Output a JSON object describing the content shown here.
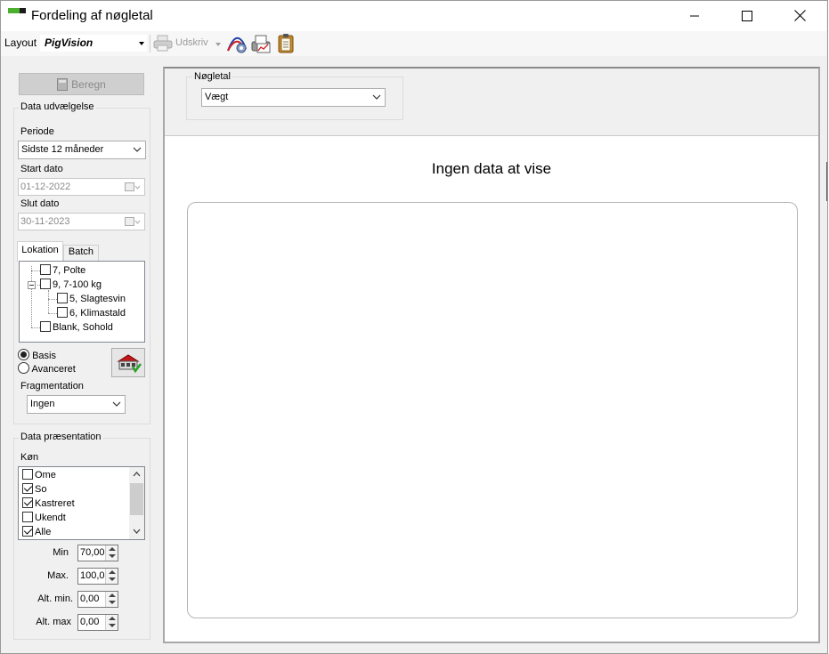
{
  "window": {
    "title": "Fordeling af nøgletal",
    "controls": [
      "minimize",
      "maximize",
      "close"
    ]
  },
  "toolbar": {
    "layout_label": "Layout",
    "layout_value": "PigVision",
    "print_label": "Udskriv",
    "icons": [
      "printer-icon",
      "settings-chart-icon",
      "print-chart-icon",
      "clipboard-icon"
    ]
  },
  "left": {
    "calculate_label": "Beregn",
    "data_selection": {
      "title": "Data udvælgelse",
      "period_label": "Periode",
      "period_value": "Sidste 12 måneder",
      "start_label": "Start dato",
      "start_value": "01-12-2022",
      "end_label": "Slut dato",
      "end_value": "30-11-2023",
      "tabs": [
        "Lokation",
        "Batch"
      ],
      "active_tab": "Lokation",
      "tree": [
        {
          "label": "7, Polte",
          "checked": false
        },
        {
          "label": "9, 7-100 kg",
          "checked": false,
          "expanded": true
        },
        {
          "label": "5, Slagtesvin",
          "checked": false
        },
        {
          "label": "6, Klimastald",
          "checked": false
        },
        {
          "label": "Blank, Sohold",
          "checked": false
        }
      ],
      "mode_options": [
        "Basis",
        "Avanceret"
      ],
      "mode_selected": "Basis",
      "fragmentation_label": "Fragmentation",
      "fragmentation_value": "Ingen"
    },
    "data_presentation": {
      "title": "Data præsentation",
      "sex_label": "Køn",
      "sex_items": [
        {
          "label": "Ome",
          "checked": false
        },
        {
          "label": "So",
          "checked": true
        },
        {
          "label": "Kastreret",
          "checked": true
        },
        {
          "label": "Ukendt",
          "checked": false
        },
        {
          "label": "Alle",
          "checked": true
        }
      ],
      "min_label": "Min",
      "min_value": "70,00",
      "max_label": "Max.",
      "max_value": "100,0",
      "alt_min_label": "Alt. min.",
      "alt_min_value": "0,00",
      "alt_max_label": "Alt. max",
      "alt_max_value": "0,00"
    }
  },
  "main": {
    "keyfigure_label": "Nøgletal",
    "keyfigure_value": "Vægt",
    "chart_message": "Ingen data at vise"
  },
  "colors": {
    "panel_bg": "#f0f0f0",
    "brand_green": "#4caf2e"
  }
}
